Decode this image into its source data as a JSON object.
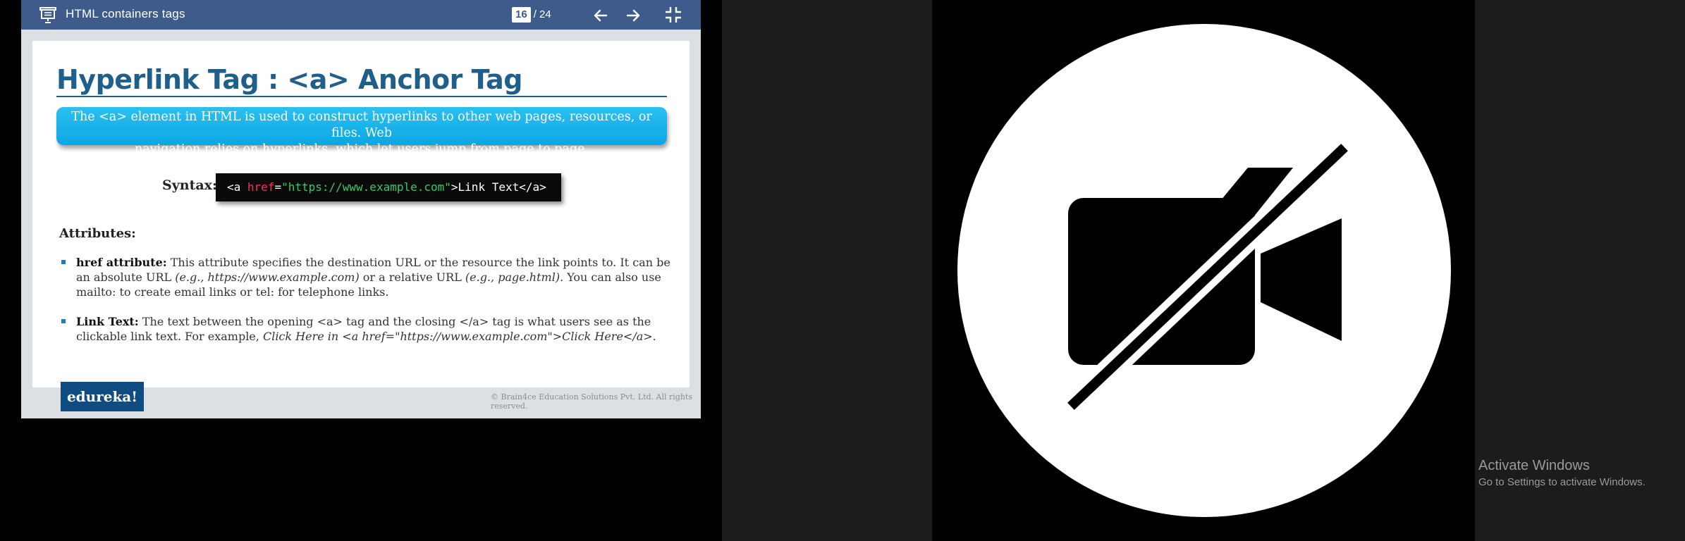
{
  "presentation": {
    "title": "HTML containers tags",
    "page_current": "16",
    "page_total": "/ 24"
  },
  "slide": {
    "heading": "Hyperlink Tag : <a>  Anchor Tag",
    "intro_line1": "The <a> element in HTML is used to construct hyperlinks to other web pages, resources, or files. Web",
    "intro_line2": "navigation relies on hyperlinks, which let users jump from page to page.",
    "syntax_label": "Syntax:",
    "code": {
      "open": "<a ",
      "attr": "href",
      "eq": "=",
      "value": "\"https://www.example.com\"",
      "rest": ">Link Text</a>"
    },
    "attributes_heading": "Attributes:",
    "bullets": [
      {
        "term": "href attribute:",
        "p1": " This attribute specifies the destination URL or the resource the link points to. It can be an absolute URL ",
        "i1": "(e.g., https://www.example.com)",
        "p2": " or a relative URL ",
        "i2": "(e.g., page.html)",
        "p3": ". You can also use mailto: to create email links or tel: for telephone links."
      },
      {
        "term": "Link Text:",
        "p1": " The text between the opening <a> tag and the closing </a> tag is what users see as the clickable link text. For example, ",
        "i1": "Click Here in <a href=\"https://www.example.com\">Click Here</a>",
        "p2": "."
      }
    ],
    "logo": "edureka!",
    "copyright": "© Brain4ce Education Solutions Pvt. Ltd. All rights reserved."
  },
  "video": {
    "icon": "camera-off-icon"
  },
  "windows_watermark": {
    "title": "Activate Windows",
    "subtitle": "Go to Settings to activate Windows."
  },
  "colors": {
    "toolbar": "#3f5b8b",
    "heading": "#1f5f8b",
    "intro_box": "#0aa6e4",
    "code_attr": "#ff2f6a",
    "code_string": "#33cc66",
    "logo_bg": "#0f4c81"
  }
}
